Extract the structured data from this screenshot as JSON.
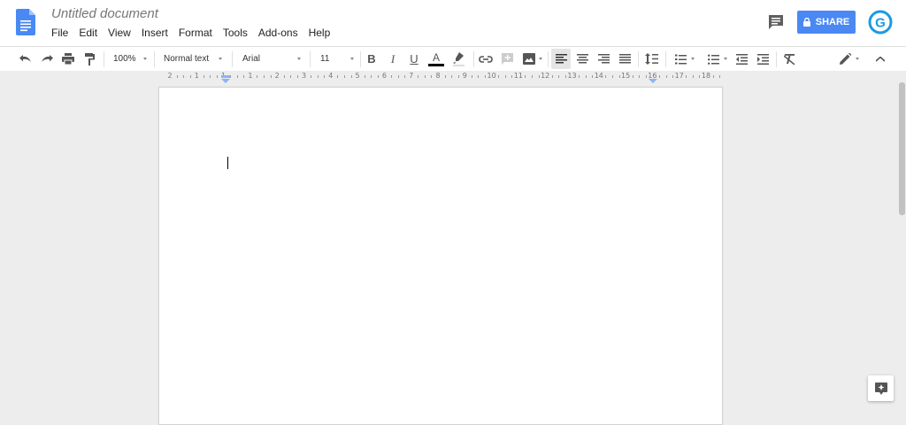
{
  "document": {
    "title": "Untitled document"
  },
  "menu": {
    "items": [
      "File",
      "Edit",
      "View",
      "Insert",
      "Format",
      "Tools",
      "Add-ons",
      "Help"
    ]
  },
  "header": {
    "share_label": "SHARE",
    "share_color": "#4a89f3",
    "avatar_letter": "G",
    "avatar_color": "#1a9ae5"
  },
  "toolbar": {
    "zoom": "100%",
    "style": "Normal text",
    "font": "Arial",
    "font_size": "11",
    "text_color": "#000000",
    "icons": {
      "undo": "undo-icon",
      "redo": "redo-icon",
      "print": "print-icon",
      "paint_format": "paint-format-icon",
      "bold": "B",
      "italic": "I",
      "underline": "U",
      "text_color": "A",
      "highlight": "highlight-icon",
      "link": "link-icon",
      "comment": "add-comment-icon",
      "image": "image-icon",
      "align_left": "align-left-icon",
      "align_center": "align-center-icon",
      "align_right": "align-right-icon",
      "justify": "justify-icon",
      "line_spacing": "line-spacing-icon",
      "numbered_list": "numbered-list-icon",
      "bulleted_list": "bulleted-list-icon",
      "decrease_indent": "decrease-indent-icon",
      "increase_indent": "increase-indent-icon",
      "clear_formatting": "clear-formatting-icon",
      "editing_mode": "pencil-icon",
      "collapse": "chevron-up-icon"
    }
  },
  "ruler": {
    "labels": [
      "2",
      "1",
      "1",
      "1",
      "2",
      "3",
      "4",
      "5",
      "6",
      "7",
      "8",
      "9",
      "10",
      "11",
      "12",
      "13",
      "14",
      "15",
      "16",
      "17",
      "18"
    ]
  }
}
